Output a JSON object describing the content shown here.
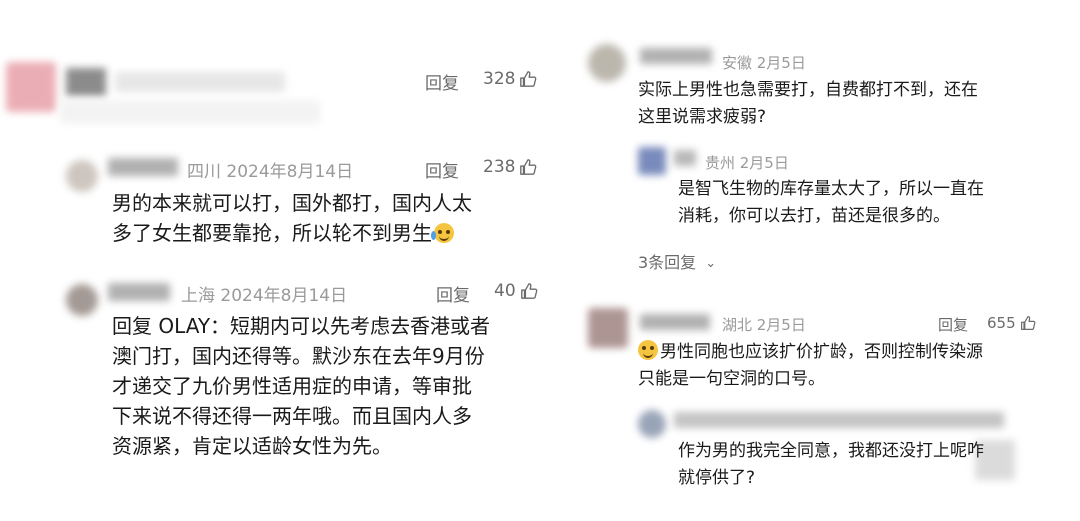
{
  "left_column": {
    "comment1": {
      "reply_label": "回复",
      "likes": "328"
    },
    "comment2": {
      "location_date": "四川 2024年8月14日",
      "reply_label": "回复",
      "likes": "238",
      "text_lines": [
        "男的本来就可以打，国外都打，国内人太",
        "多了女生都要靠抢，所以轮不到男生"
      ],
      "emoji": "cry-laugh-emoji"
    },
    "comment3": {
      "location_date": "上海 2024年8月14日",
      "reply_label": "回复",
      "likes": "40",
      "text_lines": [
        "回复 OLAY：短期内可以先考虑去香港或者",
        "澳门打，国内还得等。默沙东在去年9月份",
        "才递交了九价男性适用症的申请，等审批",
        "下来说不得还得一两年哦。而且国内人多",
        "资源紧，肯定以适龄女性为先。"
      ]
    }
  },
  "right_column": {
    "comment1": {
      "location_date": "安徽 2月5日",
      "text_lines": [
        "实际上男性也急需要打，自费都打不到，还在",
        "这里说需求疲弱?"
      ],
      "reply": {
        "location_date": "贵州 2月5日",
        "text_lines": [
          "是智飞生物的库存量太大了，所以一直在",
          "消耗，你可以去打，苗还是很多的。"
        ]
      },
      "more_replies": "3条回复"
    },
    "comment2": {
      "location_date": "湖北 2月5日",
      "reply_label": "回复",
      "likes": "655",
      "emoji": "smile-emoji",
      "text_lines": [
        "男性同胞也应该扩价扩龄，否则控制传染源",
        "只能是一句空洞的口号。"
      ],
      "reply": {
        "text_lines": [
          "作为男的我完全同意，我都还没打上呢咋",
          "就停供了?"
        ]
      }
    }
  },
  "colors": {
    "text": "#1a1a1a",
    "meta": "#9a9a9a",
    "action": "#6b6b6b",
    "background": "#ffffff"
  }
}
